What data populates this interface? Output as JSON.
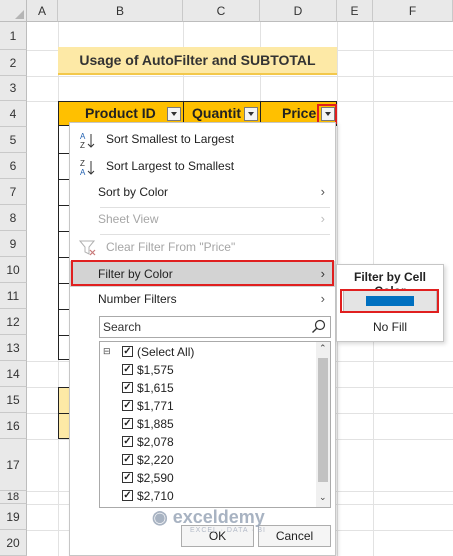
{
  "sheet": {
    "columns": [
      "A",
      "B",
      "C",
      "D",
      "E",
      "F"
    ],
    "rows": [
      "1",
      "2",
      "3",
      "4",
      "5",
      "6",
      "7",
      "8",
      "9",
      "10",
      "11",
      "12",
      "13",
      "14",
      "15",
      "16",
      "17",
      "18",
      "19",
      "20"
    ],
    "title": "Usage of AutoFilter and SUBTOTAL",
    "headers": [
      "Product ID",
      "Quantit",
      "Price"
    ]
  },
  "menu": {
    "sort_asc": "Sort Smallest to Largest",
    "sort_desc": "Sort Largest to Smallest",
    "sort_color": "Sort by Color",
    "sheet_view": "Sheet View",
    "clear_filter": "Clear Filter From \"Price\"",
    "filter_color": "Filter by Color",
    "number_filters": "Number Filters",
    "search_placeholder": "Search",
    "list_items": [
      "(Select All)",
      "$1,575",
      "$1,615",
      "$1,771",
      "$1,885",
      "$2,078",
      "$2,220",
      "$2,590",
      "$2,710"
    ],
    "ok": "OK",
    "cancel": "Cancel"
  },
  "submenu": {
    "title": "Filter by Cell Color",
    "swatch_color": "#0070c0",
    "no_fill": "No Fill"
  },
  "watermark": {
    "name": "exceldemy",
    "tagline": "EXCEL · DATA · BI"
  },
  "colors": {
    "header_fill": "#ffc000",
    "title_fill": "#fde9a6",
    "highlight_border": "#e01f1f"
  }
}
